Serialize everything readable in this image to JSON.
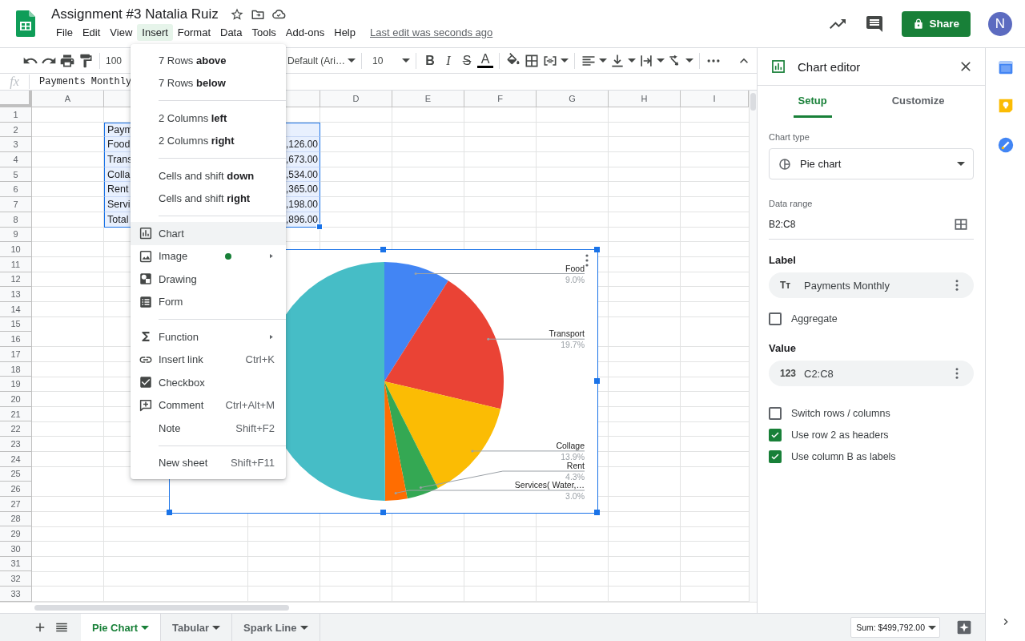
{
  "document": {
    "title": "Assignment #3 Natalia Ruiz",
    "last_edit": "Last edit was seconds ago"
  },
  "menubar": [
    {
      "label": "File",
      "selected": false
    },
    {
      "label": "Edit",
      "selected": false
    },
    {
      "label": "View",
      "selected": false
    },
    {
      "label": "Insert",
      "selected": true
    },
    {
      "label": "Format",
      "selected": false
    },
    {
      "label": "Data",
      "selected": false
    },
    {
      "label": "Tools",
      "selected": false
    },
    {
      "label": "Add-ons",
      "selected": false
    },
    {
      "label": "Help",
      "selected": false
    }
  ],
  "account": {
    "share": "Share",
    "avatar": "N"
  },
  "toolbar": {
    "zoom": "100",
    "font": "Default (Ari…",
    "font_size": "10",
    "text_styles": [
      "B",
      "I",
      "S",
      "A"
    ]
  },
  "formula_bar": {
    "label": "fx",
    "content": "Payments Monthly"
  },
  "sheet": {
    "columns": [
      {
        "label": "A"
      },
      {},
      {},
      {
        "label": "D"
      },
      {
        "label": "E"
      },
      {
        "label": "F"
      },
      {
        "label": "G"
      },
      {
        "label": "H"
      },
      {
        "label": "I"
      }
    ],
    "rows": [
      {
        "number": "1"
      },
      {
        "number": "2",
        "cells": [
          {
            "text": "Paym",
            "selected": true
          },
          {
            "selected": true
          }
        ]
      },
      {
        "number": "3",
        "cells": [
          {
            "text": "Food",
            "selected": true
          },
          {
            "text": ",126.00",
            "selected": true
          }
        ]
      },
      {
        "number": "4",
        "cells": [
          {
            "text": "Trans",
            "selected": true
          },
          {
            "text": ",673.00",
            "selected": true
          }
        ]
      },
      {
        "number": "5",
        "cells": [
          {
            "text": "Colla",
            "selected": true
          },
          {
            "text": ",534.00",
            "selected": true
          }
        ]
      },
      {
        "number": "6",
        "cells": [
          {
            "text": "Rent",
            "selected": true
          },
          {
            "text": ",365.00",
            "selected": true
          }
        ]
      },
      {
        "number": "7",
        "cells": [
          {
            "text": "Servi",
            "selected": true
          },
          {
            "text": ",198.00",
            "selected": true
          }
        ]
      },
      {
        "number": "8",
        "cells": [
          {
            "text": "Total",
            "selected": true
          },
          {
            "text": ",896.00",
            "selected": true
          }
        ]
      },
      {
        "number": "9"
      },
      {
        "number": "10"
      },
      {
        "number": "11"
      },
      {
        "number": "12"
      },
      {
        "number": "13"
      },
      {
        "number": "14"
      },
      {
        "number": "15"
      },
      {
        "number": "16"
      },
      {
        "number": "17"
      },
      {
        "number": "18"
      },
      {
        "number": "19"
      },
      {
        "number": "20"
      },
      {
        "number": "21"
      },
      {
        "number": "22"
      },
      {
        "number": "23"
      },
      {
        "number": "24"
      },
      {
        "number": "25"
      },
      {
        "number": "26"
      },
      {
        "number": "27"
      },
      {
        "number": "28"
      },
      {
        "number": "29"
      },
      {
        "number": "30"
      },
      {
        "number": "31"
      },
      {
        "number": "32"
      },
      {
        "number": "33"
      }
    ]
  },
  "chart": {
    "selected": true,
    "chart_data": {
      "type": "pie",
      "categories": [
        "Food",
        "Transport",
        "Collage",
        "Rent",
        "Services( Water,…",
        null
      ],
      "values": [
        9.0,
        19.7,
        13.9,
        4.3,
        3.0,
        50.1
      ],
      "data_labels": "value_labels",
      "value_labels": [
        "9.0%",
        "19.7%",
        "13.9%",
        "4.3%",
        "3.0%",
        null
      ]
    }
  },
  "insert_menu": {
    "items": [
      {
        "kind": "item",
        "label": "7 Rows **above**",
        "selected": false,
        "submenu": false,
        "new": false
      },
      {
        "kind": "item",
        "label": "7 Rows **below**",
        "selected": false,
        "submenu": false,
        "new": false
      },
      {
        "kind": "separator"
      },
      {
        "kind": "item",
        "label": "2 Columns **left**",
        "selected": false,
        "submenu": false,
        "new": false
      },
      {
        "kind": "item",
        "label": "2 Columns **right**",
        "selected": false,
        "submenu": false,
        "new": false
      },
      {
        "kind": "separator"
      },
      {
        "kind": "item",
        "label": "Cells and shift **down**",
        "selected": false,
        "submenu": false,
        "new": false
      },
      {
        "kind": "item",
        "label": "Cells and shift **right**",
        "selected": false,
        "submenu": false,
        "new": false
      },
      {
        "kind": "separator"
      },
      {
        "kind": "item",
        "label": "Chart",
        "selected": true,
        "submenu": false,
        "new": false
      },
      {
        "kind": "item",
        "label": "Image",
        "selected": false,
        "submenu": true,
        "new": true
      },
      {
        "kind": "item",
        "label": "Drawing",
        "selected": false,
        "submenu": false,
        "new": false
      },
      {
        "kind": "item",
        "label": "Form",
        "selected": false,
        "submenu": false,
        "new": false
      },
      {
        "kind": "separator"
      },
      {
        "kind": "item",
        "label": "Function",
        "selected": false,
        "submenu": true,
        "new": false
      },
      {
        "kind": "item",
        "label": "Insert link",
        "shortcut": "Ctrl+K",
        "selected": false,
        "submenu": false,
        "new": false
      },
      {
        "kind": "item",
        "label": "Checkbox",
        "selected": false,
        "submenu": false,
        "new": false
      },
      {
        "kind": "item",
        "label": "Comment",
        "shortcut": "Ctrl+Alt+M",
        "selected": false,
        "submenu": false,
        "new": false
      },
      {
        "kind": "item",
        "label": "Note",
        "shortcut": "Shift+F2",
        "selected": false,
        "submenu": false,
        "new": false
      },
      {
        "kind": "separator"
      },
      {
        "kind": "item",
        "label": "New sheet",
        "shortcut": "Shift+F11",
        "selected": false,
        "submenu": false,
        "new": false
      }
    ]
  },
  "chart_editor": {
    "title": "Chart editor",
    "tabs": [
      {
        "label": "Setup",
        "selected": true
      },
      {
        "label": "Customize",
        "selected": false
      }
    ],
    "chart_type_label": "Chart type",
    "chart_type": "Pie chart",
    "data_range_label": "Data range",
    "data_range": "B2:C8",
    "label_heading": "Label",
    "label_chip": {
      "badge": "Tт",
      "text": "Payments Monthly"
    },
    "aggregate": {
      "label": "Aggregate",
      "checked": false
    },
    "value_heading": "Value",
    "value_chip": {
      "badge": "123",
      "text": "C2:C8"
    },
    "options": [
      {
        "label": "Switch rows / columns",
        "checked": false
      },
      {
        "label": "Use row 2 as headers",
        "checked": true
      },
      {
        "label": "Use column B as labels",
        "checked": true
      }
    ]
  },
  "sheet_tabs": [
    {
      "label": "Pie Chart",
      "selected": true
    },
    {
      "label": "Tabular",
      "selected": false
    },
    {
      "label": "Spark Line",
      "selected": false
    }
  ],
  "status": {
    "sum": "Sum: $499,792.00"
  }
}
